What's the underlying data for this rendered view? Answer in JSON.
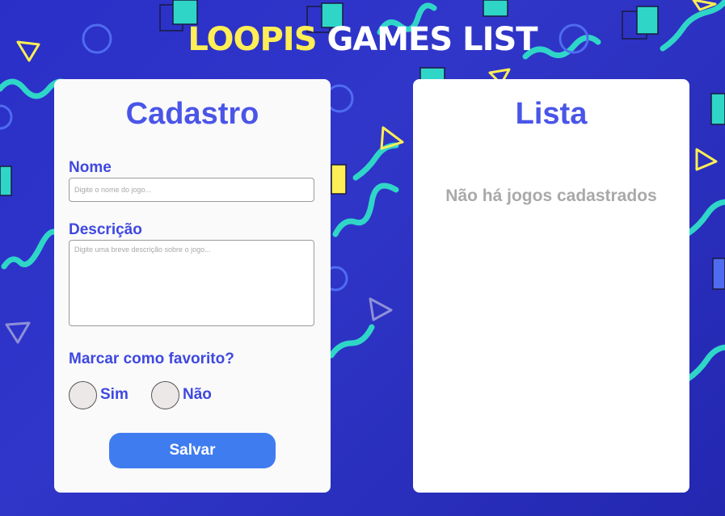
{
  "header": {
    "brand": "LOOPIS",
    "title_rest": "GAMES LIST"
  },
  "form": {
    "title": "Cadastro",
    "name_label": "Nome",
    "name_placeholder": "Digite o nome do jogo...",
    "description_label": "Descrição",
    "description_placeholder": "Digite uma breve descrição sobre o jogo...",
    "favorite_label": "Marcar como favorito?",
    "options": [
      {
        "label": "Sim",
        "selected": false
      },
      {
        "label": "Não",
        "selected": false
      }
    ],
    "save_label": "Salvar"
  },
  "list": {
    "title": "Lista",
    "empty_message": "Não há jogos cadastrados"
  },
  "colors": {
    "background": "#2a2fc8",
    "brand_yellow": "#ffee55",
    "accent_blue": "#4a55e8",
    "button_blue": "#3f7cf0",
    "teal": "#2fd6c8"
  }
}
